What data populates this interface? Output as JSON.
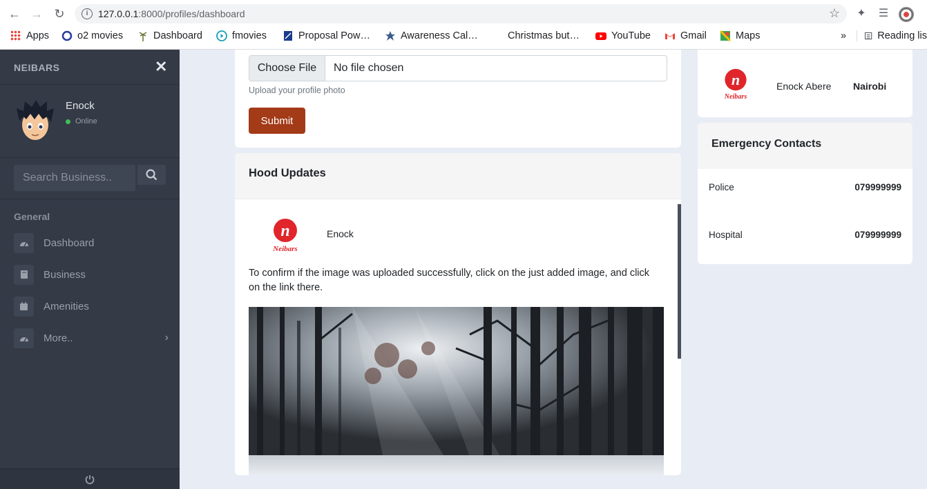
{
  "browser": {
    "url_host": "127.0.0.1",
    "url_rest": ":8000/profiles/dashboard",
    "bookmarks": [
      {
        "label": "Apps",
        "icon": "apps-grid-icon"
      },
      {
        "label": "o2 movies",
        "icon": "o2-icon"
      },
      {
        "label": "Dashboard",
        "icon": "palm-icon"
      },
      {
        "label": "fmovies",
        "icon": "play-circle-icon"
      },
      {
        "label": "Proposal Pow…",
        "icon": "document-icon"
      },
      {
        "label": "Awareness Cal…",
        "icon": "star-icon"
      },
      {
        "label": "Christmas but…",
        "icon": ""
      },
      {
        "label": "YouTube",
        "icon": "youtube-icon"
      },
      {
        "label": "Gmail",
        "icon": "gmail-icon"
      },
      {
        "label": "Maps",
        "icon": "maps-icon"
      }
    ],
    "more_bookmarks": "»",
    "reading_list": "Reading lis"
  },
  "sidebar": {
    "brand": "NEIBARS",
    "user_name": "Enock",
    "user_status": "Online",
    "search_placeholder": "Search Business..",
    "section_label": "General",
    "items": [
      {
        "label": "Dashboard",
        "icon": "dashboard-gauge-icon"
      },
      {
        "label": "Business",
        "icon": "book-icon"
      },
      {
        "label": "Amenities",
        "icon": "calendar-icon"
      },
      {
        "label": "More..",
        "icon": "gauge-icon"
      }
    ]
  },
  "upload": {
    "choose_label": "Choose File",
    "file_status": "No file chosen",
    "hint": "Upload your profile photo",
    "submit_label": "Submit"
  },
  "hood": {
    "title": "Hood Updates",
    "post": {
      "author": "Enock",
      "text": "To confirm if the image was uploaded successfully, click on the just added image, and click on the link there."
    }
  },
  "profile": {
    "name": "Enock Abere",
    "location": "Nairobi"
  },
  "emergency": {
    "title": "Emergency Contacts",
    "contacts": [
      {
        "name": "Police",
        "number": "079999999"
      },
      {
        "name": "Hospital",
        "number": "079999999"
      }
    ]
  },
  "logo_text": {
    "letter": "n",
    "word": "Neibars"
  },
  "colors": {
    "submit": "#a33a18",
    "sidebar": "#343a46",
    "logo_red": "#e0262b",
    "online": "#3fbf5a"
  }
}
